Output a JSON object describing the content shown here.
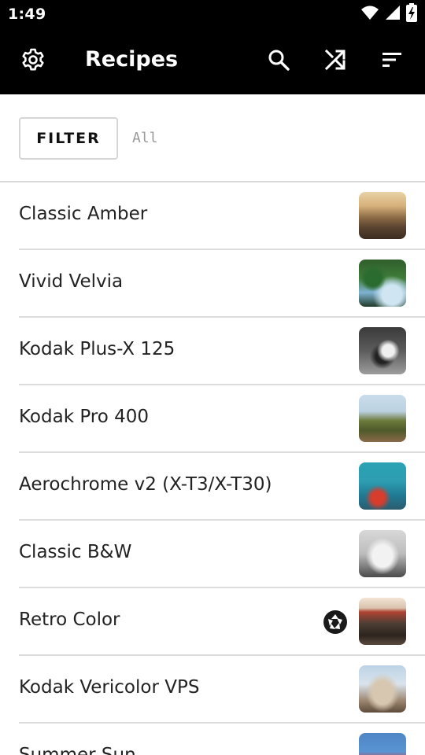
{
  "status_bar": {
    "time": "1:49",
    "icons": [
      "wifi-icon",
      "cellular-signal-icon",
      "battery-charging-icon"
    ]
  },
  "app_bar": {
    "title": "Recipes",
    "icons": {
      "settings": "gear-icon",
      "search": "search-icon",
      "shuffle": "shuffle-icon",
      "sort": "sort-icon"
    }
  },
  "filter": {
    "button_label": "FILTER",
    "value": "All"
  },
  "recipes": [
    {
      "name": "Classic Amber",
      "thumb": "landscape-photo-thumb",
      "aperture_icon": false
    },
    {
      "name": "Vivid Velvia",
      "thumb": "waterfall-photo-thumb",
      "aperture_icon": false
    },
    {
      "name": "Kodak Plus-X 125",
      "thumb": "photographer-bw-photo-thumb",
      "aperture_icon": false
    },
    {
      "name": "Kodak Pro 400",
      "thumb": "hills-photo-thumb",
      "aperture_icon": false
    },
    {
      "name": "Aerochrome v2 (X-T3/X-T30)",
      "thumb": "sea-photo-thumb",
      "aperture_icon": false
    },
    {
      "name": "Classic B&W",
      "thumb": "mission-bw-photo-thumb",
      "aperture_icon": false
    },
    {
      "name": "Retro Color",
      "thumb": "storefront-photo-thumb",
      "aperture_icon": true
    },
    {
      "name": "Kodak Vericolor VPS",
      "thumb": "mission-color-photo-thumb",
      "aperture_icon": false
    },
    {
      "name": "Summer Sun",
      "thumb": "sign-photo-thumb",
      "aperture_icon": false
    }
  ],
  "colors": {
    "app_bar": "#000000",
    "background": "#ffffff",
    "divider": "#dcdcdc",
    "text": "#222222",
    "filter_value": "#9a9a9a"
  }
}
